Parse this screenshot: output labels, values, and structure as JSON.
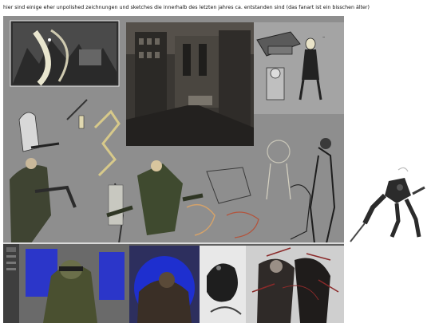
{
  "caption": "hier sind einige eher unpolished zeichnungen und sketches die innerhalb des letzten jahres ca. entstanden sind (das fanart ist ein bisschen älter)",
  "colors": {
    "sheet_bg": "#8e8e8e",
    "strip_bg": "#5f5f5f",
    "blue_accent": "#2b36c9",
    "ink": "#1a1a1a",
    "olive": "#3f4a2f",
    "sketch_line": "#c9c6b8"
  },
  "artwork": {
    "city_panel": "city-illustration",
    "tower_panel": "architecture-painting",
    "gear_panel": "character-gear-sketches",
    "figures": "character-sketches",
    "strip_panels": [
      "headphone-soldier-painting",
      "blue-room-painting",
      "creature-ink-sketch",
      "red-scribble-figures"
    ],
    "side_piece": "mech-figure"
  }
}
